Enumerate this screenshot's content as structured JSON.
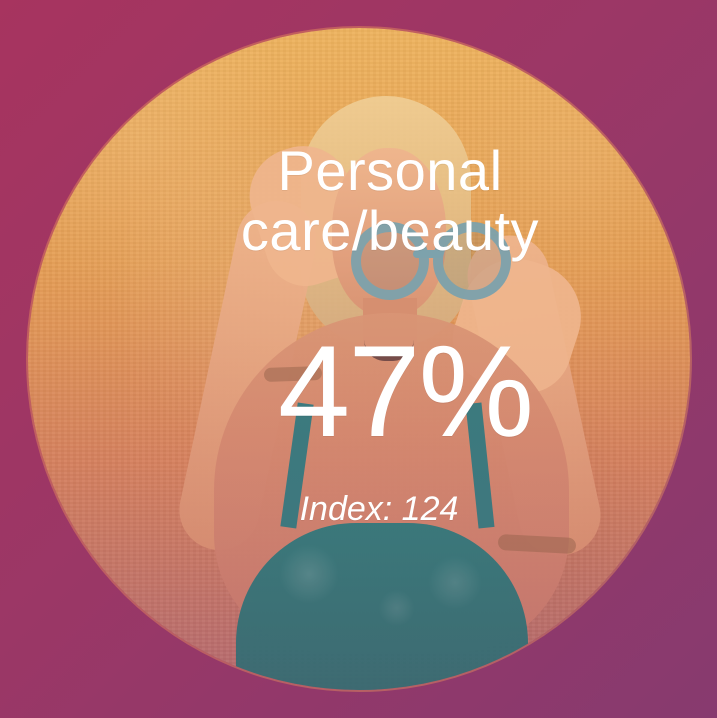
{
  "content": {
    "title": "Personal\ncare/beauty",
    "value": "47%",
    "index": "Index: 124"
  },
  "colors": {
    "background_start": "#a7345f",
    "background_end": "#873a6f",
    "text": "#ffffff",
    "circle_warm": "#efb45f",
    "top_teal": "#2f6f73"
  }
}
